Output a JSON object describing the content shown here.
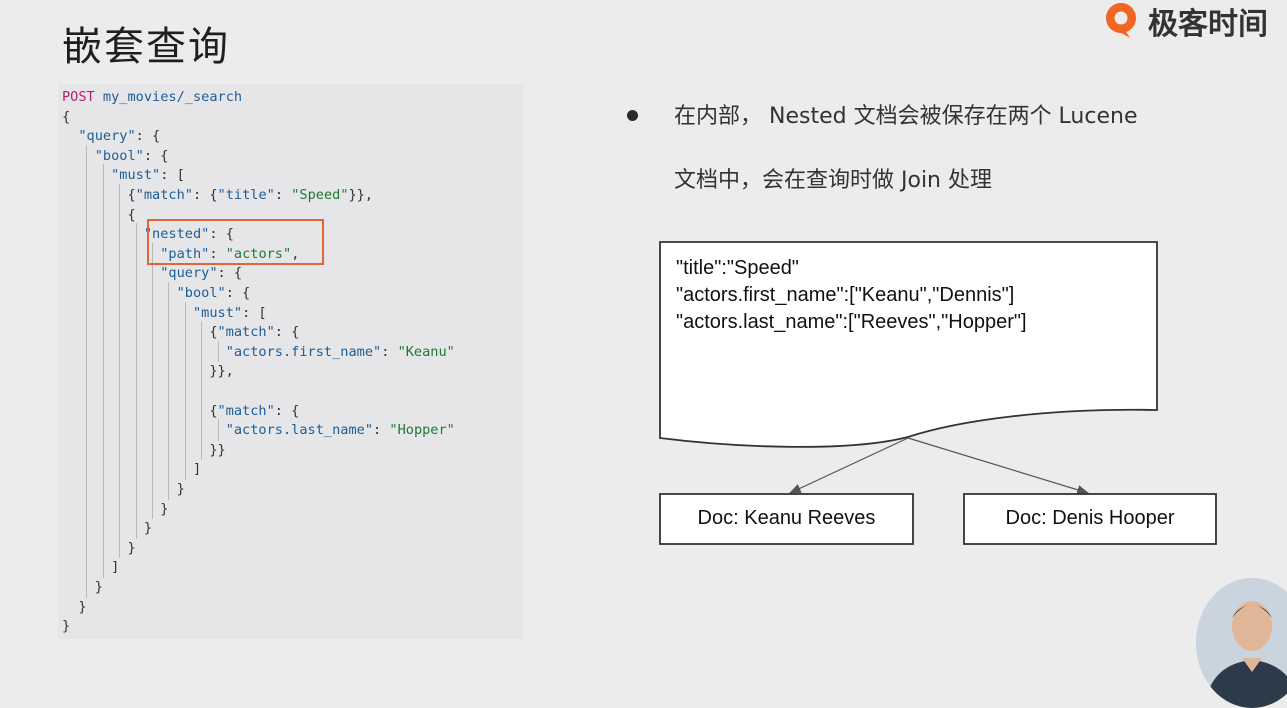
{
  "slide": {
    "title": "嵌套查询",
    "brand": {
      "logo_icon": "geekbang-logo-icon",
      "name": "极客时间"
    }
  },
  "code": {
    "request_line": {
      "method": "POST",
      "path": "my_movies/_search"
    },
    "lines": [
      "{",
      "  \"query\": {",
      "    \"bool\": {",
      "      \"must\": [",
      "        {\"match\": {\"title\": \"Speed\"}},",
      "        {",
      "          \"nested\": {",
      "            \"path\": \"actors\",",
      "            \"query\": {",
      "              \"bool\": {",
      "                \"must\": [",
      "                  {\"match\": {",
      "                    \"actors.first_name\": \"Keanu\"",
      "                  }},",
      "",
      "                  {\"match\": {",
      "                    \"actors.last_name\": \"Hopper\"",
      "                  }}",
      "                ]",
      "              }",
      "            }",
      "          }",
      "        }",
      "      ]",
      "    }",
      "  }",
      "}"
    ],
    "highlight_color": "#e0653a"
  },
  "bullet": {
    "line1": "在内部， Nested 文档会被保存在两个 Lucene",
    "line2": "文档中，会在查询时做 Join 处理"
  },
  "diagram": {
    "source_doc_lines": [
      "\"title\":\"Speed\"",
      "\"actors.first_name\":[\"Keanu\",\"Dennis\"]",
      "\"actors.last_name\":[\"Reeves\",\"Hopper\"]"
    ],
    "targets": [
      "Doc: Keanu Reeves",
      "Doc: Denis Hooper"
    ]
  },
  "presenter": {
    "icon": "presenter-avatar-icon"
  }
}
